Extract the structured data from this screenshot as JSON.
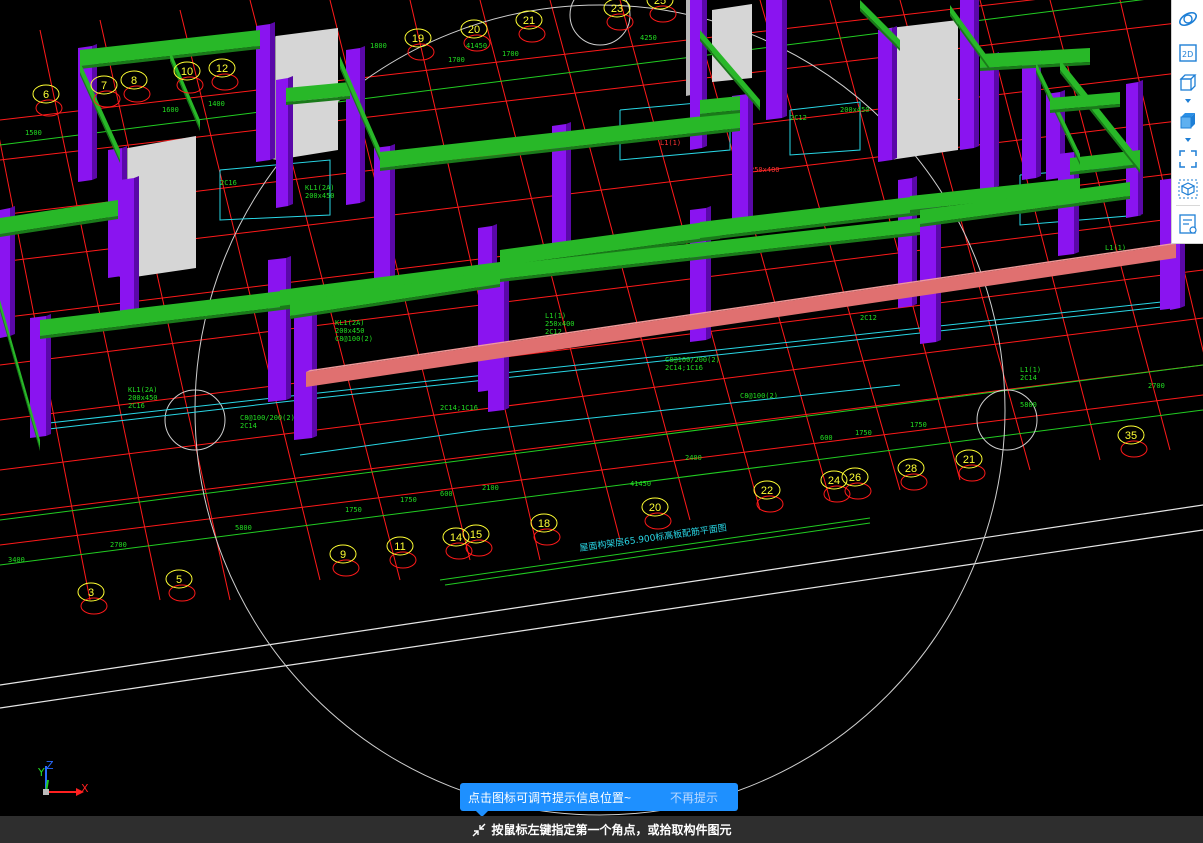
{
  "canvas": {
    "bg_color": "#000000",
    "grid_colors": {
      "red": "#ff1a1a",
      "green": "#22cc22",
      "cyan": "#29d7e6",
      "yellow": "#ffff33"
    },
    "element_colors": {
      "column": "#8a14f0",
      "column_dark": "#5a08a8",
      "beam": "#28b828",
      "beam_dark": "#1a7a1a",
      "wall": "#d6d6d6",
      "wall_dark": "#9a9a9a",
      "selected_beam": "#e07070"
    },
    "axis_bubbles_top": [
      "6",
      "7",
      "8",
      "10",
      "12",
      "19",
      "20",
      "21",
      "23",
      "25"
    ],
    "axis_bubbles_bottom": [
      "3",
      "5",
      "9",
      "11",
      "14",
      "15",
      "18",
      "20",
      "22",
      "24",
      "26",
      "28",
      "21",
      "35"
    ],
    "dimensions": [
      "3400",
      "2700",
      "5800",
      "1750",
      "600",
      "2100",
      "2400",
      "41450",
      "600",
      "1750",
      "1750",
      "1500",
      "1700",
      "1700",
      "1400",
      "1600",
      "1400",
      "2700",
      "5800",
      "4250",
      "1800"
    ],
    "plan_title": "屋面构架层65.900标高板配筋平面图",
    "annotations": [
      "2C14",
      "C8@100/200(2)",
      "KL1(2A)",
      "200x450",
      "2C16",
      "C8@100(2)",
      "L1(1)",
      "250x400",
      "2C12",
      "2C14;1C16"
    ]
  },
  "axis_gizmo": {
    "y": "Y",
    "z": "Z",
    "x": "X"
  },
  "toolbar": {
    "buttons": [
      {
        "name": "orbit",
        "icon": "orbit-icon"
      },
      {
        "name": "2d-view",
        "icon": "2d-view-icon",
        "label": "2D"
      },
      {
        "name": "3d-box-view",
        "icon": "3d-box-icon"
      },
      {
        "name": "3d-solid-view",
        "icon": "3d-solid-icon"
      },
      {
        "name": "fullscreen",
        "icon": "fullscreen-icon"
      },
      {
        "name": "cube-select",
        "icon": "cube-select-icon"
      },
      {
        "name": "list-view",
        "icon": "list-view-icon"
      }
    ]
  },
  "tip": {
    "message": "点击图标可调节提示信息位置~",
    "dismiss": "不再提示"
  },
  "status": {
    "prompt": "按鼠标左键指定第一个角点，或拾取构件图元"
  }
}
